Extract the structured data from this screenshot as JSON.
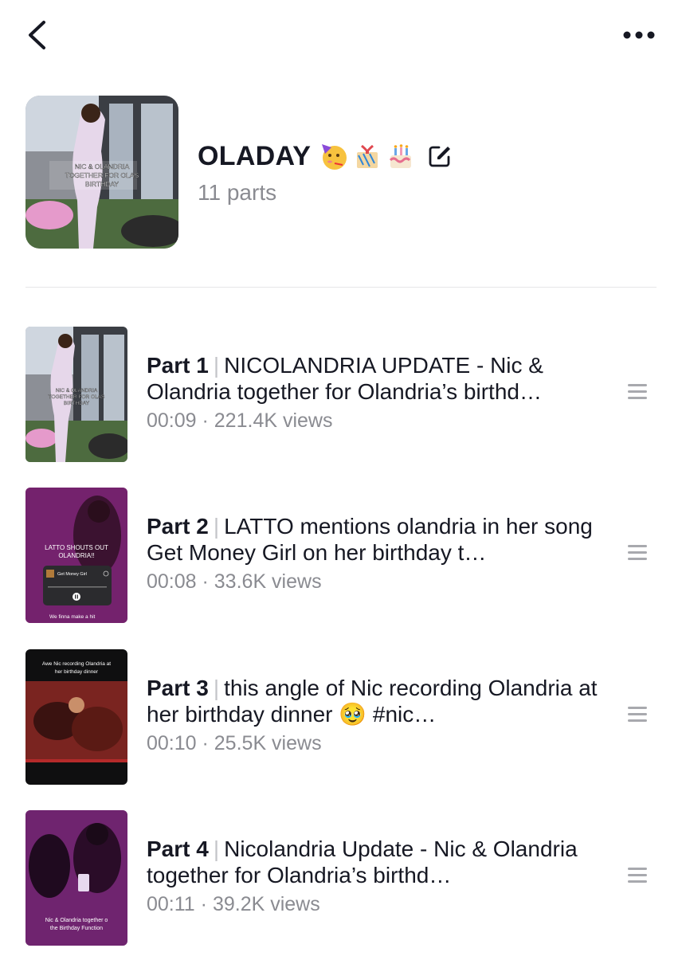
{
  "nav": {
    "back_icon": "chevron-left-icon",
    "more_icon": "more-horizontal-icon"
  },
  "playlist": {
    "title": "OLADAY",
    "emojis": [
      "partying-face",
      "wrapped-gift",
      "birthday-cake"
    ],
    "parts_count": "11 parts",
    "cover_caption": "NIC & OLANDRIA TOGETHER FOR OLAS BIRTHDAY",
    "edit_icon": "edit-icon"
  },
  "items": [
    {
      "part": "Part 1",
      "title": "NICOLANDRIA UPDATE - Nic & Olandria together for Olandria’s birthd…",
      "duration": "00:09",
      "views": "221.4K views",
      "thumb_caption": "NIC & OLANDRIA TOGETHER FOR OLAS BIRTHDAY"
    },
    {
      "part": "Part 2",
      "title": "LATTO mentions olandria in her song Get Money Girl on her birthday t…",
      "duration": "00:08",
      "views": "33.6K views",
      "thumb_caption": "LATTO SHOUTS OUT OLANDRIA!!",
      "thumb_song": "Get Money Girl",
      "thumb_artist": "Latto",
      "thumb_lyric": "We finna make a hit"
    },
    {
      "part": "Part 3",
      "title": "this angle of Nic recording Olandria at her birthday dinner 🥹 #nic…",
      "duration": "00:10",
      "views": "25.5K views",
      "thumb_caption": "Awe Nic recording Olandria at her birthday dinner"
    },
    {
      "part": "Part 4",
      "title": "Nicolandria Update - Nic & Olandria together for Olandria’s birthd…",
      "duration": "00:11",
      "views": "39.2K views",
      "thumb_caption": "Nic & Olandria together o the Birthday Function"
    }
  ],
  "colors": {
    "primary_text": "#161823",
    "secondary_text": "#8a8b91",
    "divider": "#e6e6e8"
  }
}
